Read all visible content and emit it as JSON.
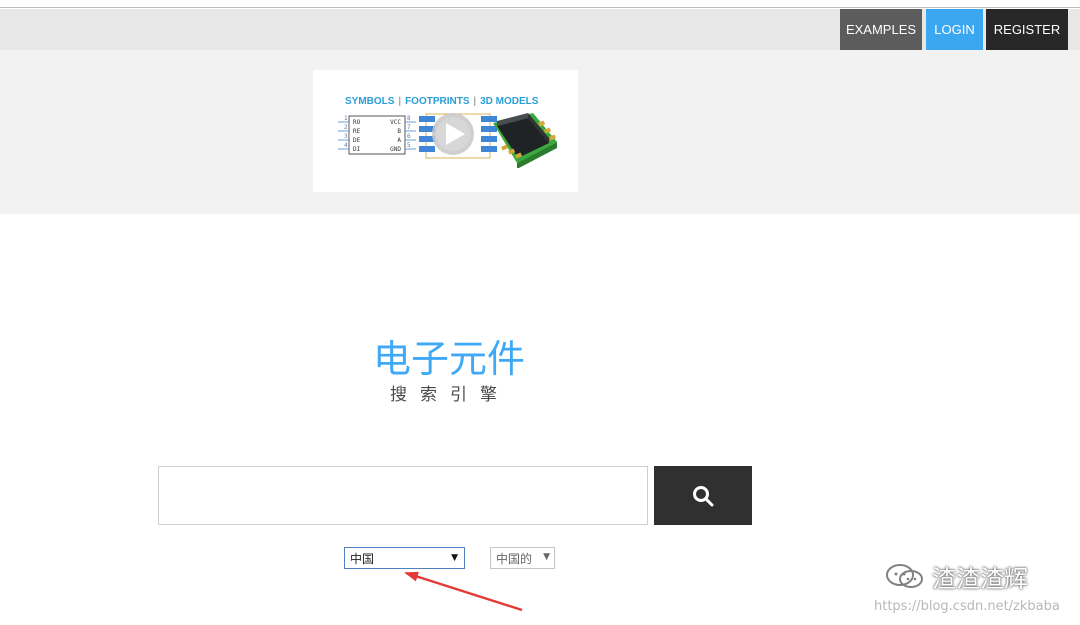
{
  "header": {
    "nav": [
      {
        "label": "EXAMPLES",
        "color": "#5c5c5c"
      },
      {
        "label": "LOGIN",
        "color": "#3ba7f1"
      },
      {
        "label": "REGISTER",
        "color": "#272727"
      }
    ]
  },
  "banner": {
    "headline_parts": [
      "SYMBOLS",
      "FOOTPRINTS",
      "3D MODELS"
    ],
    "separator": "|",
    "pins_left": [
      "1",
      "2",
      "3",
      "4"
    ],
    "pins_right": [
      "8",
      "7",
      "6",
      "5"
    ],
    "pin_names_left": [
      "RO",
      "RE",
      "DE",
      "DI"
    ],
    "pin_names_right": [
      "VCC",
      "B",
      "A",
      "GND"
    ],
    "icons": [
      "schematic-symbol-icon",
      "footprint-icon",
      "play-icon",
      "chip-3d-model-icon"
    ]
  },
  "logo": {
    "main": "电子元件",
    "sub": "搜索引擎",
    "color": "#3fa9f5"
  },
  "search": {
    "value": "",
    "placeholder": "",
    "button_icon": "search-icon"
  },
  "filters": {
    "country_selected": "中国",
    "language_selected": "中国的",
    "arrow_glyph": "▼"
  },
  "watermark": {
    "brand": "渣渣渣辉",
    "url": "https://blog.csdn.net/zkbaba",
    "icon": "wechat-icon"
  },
  "annotation": {
    "arrow_color": "#e53935"
  }
}
